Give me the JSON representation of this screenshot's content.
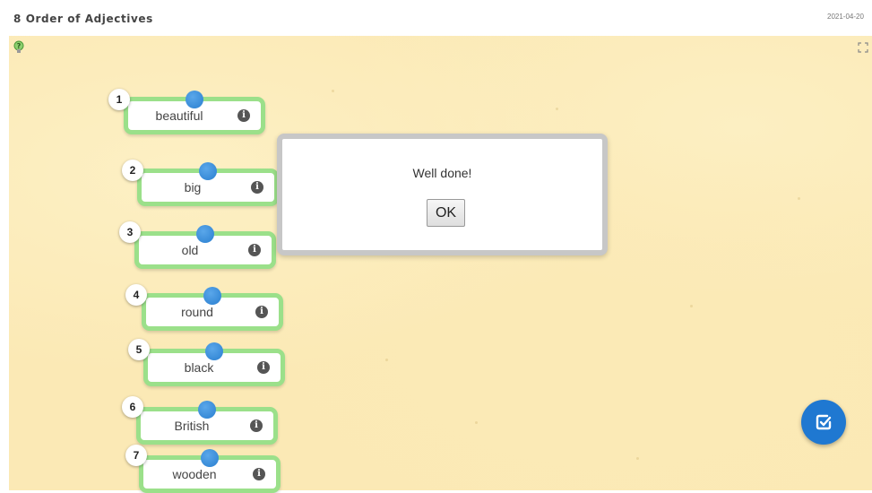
{
  "header": {
    "title": "8 Order of Adjectives",
    "date": "2021-04-20"
  },
  "toolbar": {
    "hint_icon": "lightbulb-question-icon",
    "fullscreen_icon": "fullscreen-icon"
  },
  "blocks": [
    {
      "order": "1",
      "word": "beautiful",
      "info_glyph": "i"
    },
    {
      "order": "2",
      "word": "big",
      "info_glyph": "i"
    },
    {
      "order": "3",
      "word": "old",
      "info_glyph": "i"
    },
    {
      "order": "4",
      "word": "round",
      "info_glyph": "i"
    },
    {
      "order": "5",
      "word": "black",
      "info_glyph": "i"
    },
    {
      "order": "6",
      "word": "British",
      "info_glyph": "i"
    },
    {
      "order": "7",
      "word": "wooden",
      "info_glyph": "i"
    }
  ],
  "dialog": {
    "message": "Well done!",
    "ok_label": "OK"
  },
  "check_button": {
    "icon": "check-square-icon"
  },
  "colors": {
    "background": "#fbe9b5",
    "block_border": "#9be08a",
    "connector": "#2a7fd0",
    "check_button": "#1f78d1"
  }
}
